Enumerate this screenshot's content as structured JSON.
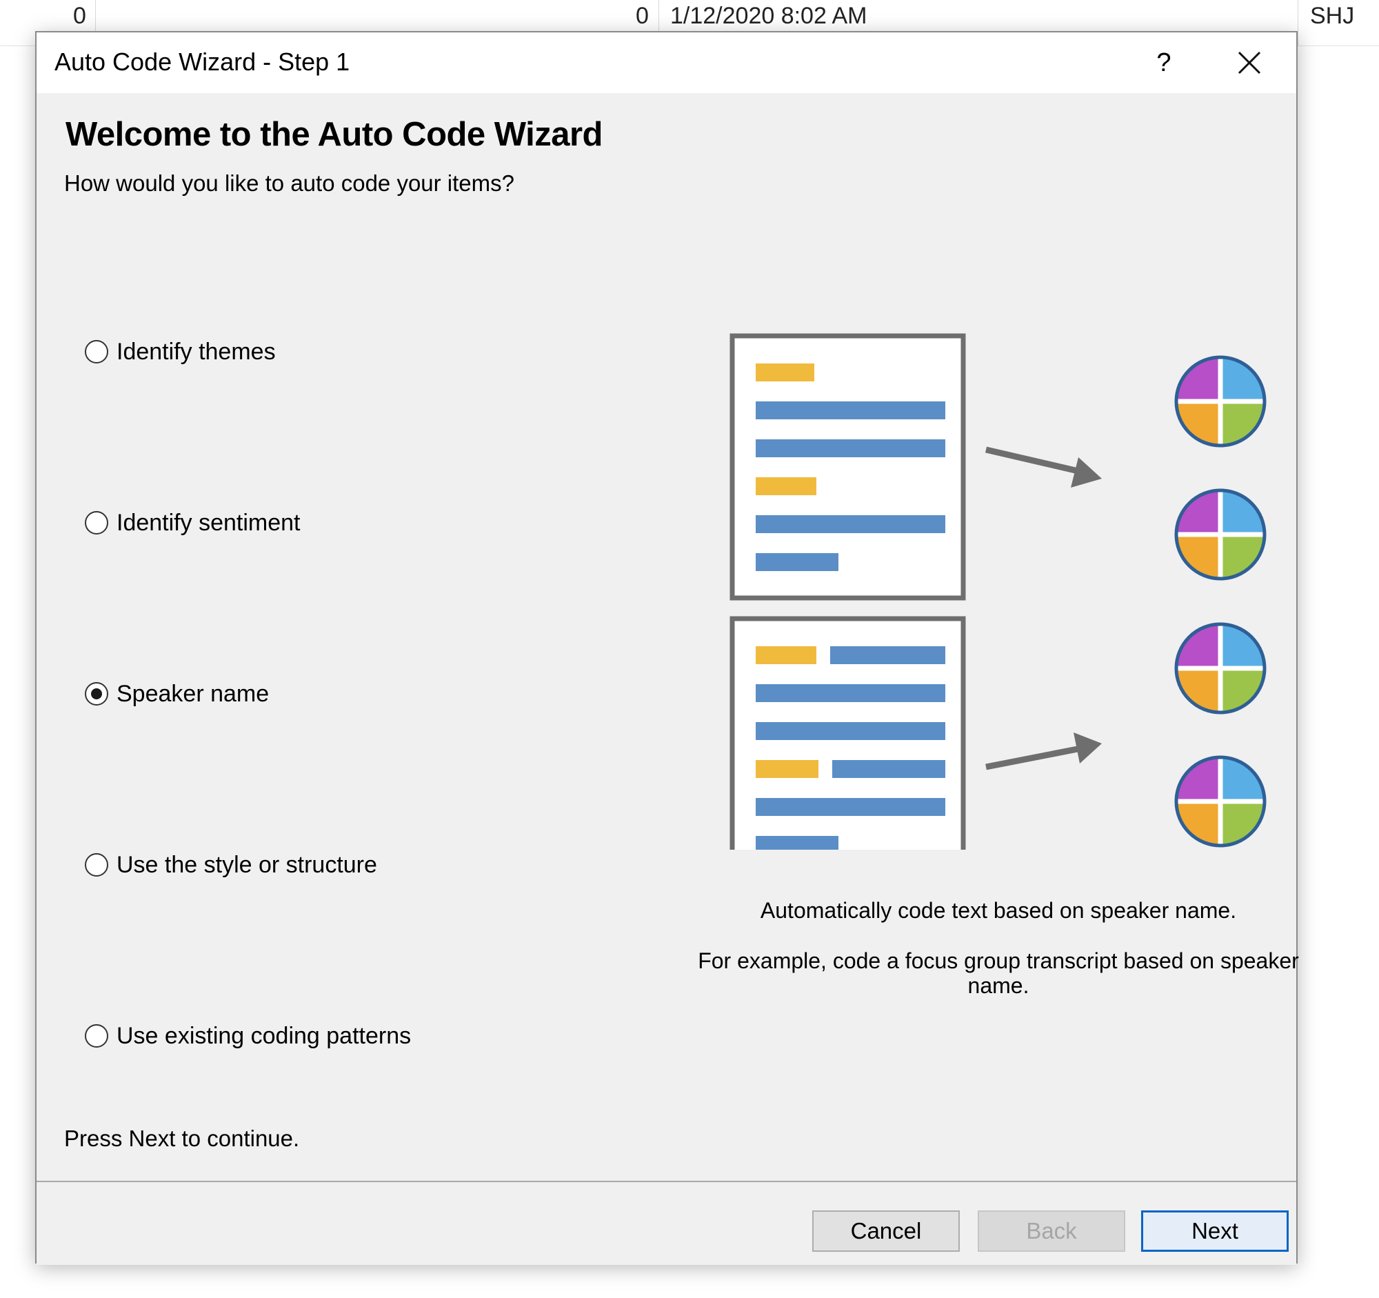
{
  "background_row": {
    "col_a": "0",
    "col_b": "0",
    "date": "1/12/2020 8:02 AM",
    "user": "SHJ"
  },
  "dialog": {
    "title": "Auto Code Wizard - Step 1",
    "help_label": "?",
    "heading": "Welcome to the Auto Code Wizard",
    "question": "How would you like to auto code your items?",
    "options": [
      {
        "label": "Identify themes",
        "checked": false
      },
      {
        "label": "Identify sentiment",
        "checked": false
      },
      {
        "label": "Speaker name",
        "checked": true
      },
      {
        "label": "Use the style or structure",
        "checked": false
      },
      {
        "label": "Use existing coding patterns",
        "checked": false
      }
    ],
    "description": "Automatically code text based on speaker name.",
    "example": "For example, code a focus group transcript based on speaker name.",
    "footer_hint": "Press Next to continue.",
    "buttons": {
      "cancel": "Cancel",
      "back": "Back",
      "next": "Next"
    }
  },
  "colors": {
    "accent": "#0a64c6",
    "doc_yellow": "#f0ba3c",
    "doc_blue": "#5b8ec6",
    "node_purple": "#b64fc8",
    "node_lightblue": "#5aaee6",
    "node_orange": "#f0a830",
    "node_green": "#9cc44a",
    "arrow_gray": "#6e6e6e"
  }
}
